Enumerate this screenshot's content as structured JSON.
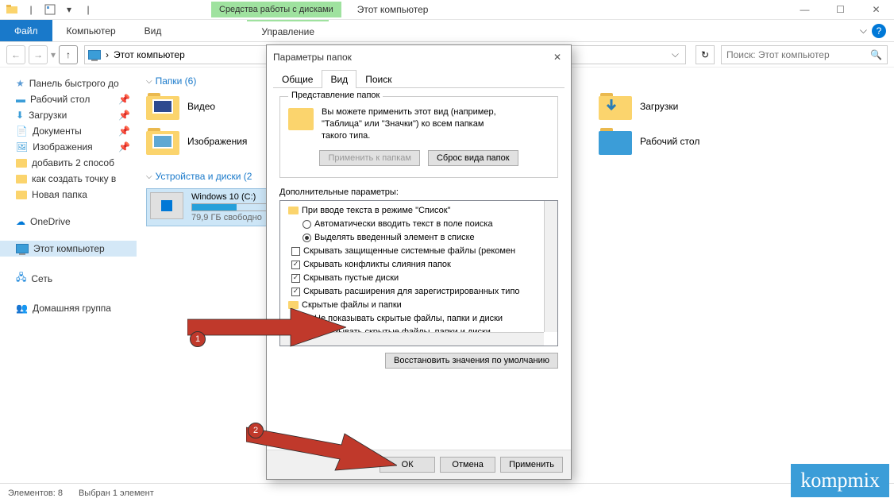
{
  "window": {
    "context_tab": "Средства работы с дисками",
    "app_title": "Этот компьютер"
  },
  "ribbon": {
    "file": "Файл",
    "computer": "Компьютер",
    "view": "Вид",
    "manage": "Управление"
  },
  "nav": {
    "location": "Этот компьютер",
    "search_placeholder": "Поиск: Этот компьютер"
  },
  "sidebar": {
    "quick": "Панель быстрого до",
    "desktop": "Рабочий стол",
    "downloads": "Загрузки",
    "documents": "Документы",
    "pictures": "Изображения",
    "add2": "добавить 2 способ",
    "howto": "как создать точку в",
    "newfolder": "Новая папка",
    "onedrive": "OneDrive",
    "thispc": "Этот компьютер",
    "network": "Сеть",
    "homegroup": "Домашняя группа"
  },
  "main": {
    "folders_header": "Папки (6)",
    "video": "Видео",
    "images": "Изображения",
    "downloads": "Загрузки",
    "desktop": "Рабочий стол",
    "drives_header": "Устройства и диски (2",
    "drive_name": "Windows 10 (C:)",
    "drive_free": "79,9 ГБ свободно"
  },
  "dialog": {
    "title": "Параметры папок",
    "tab_general": "Общие",
    "tab_view": "Вид",
    "tab_search": "Поиск",
    "fieldset_title": "Представление папок",
    "fieldset_text1": "Вы можете применить этот вид (например,",
    "fieldset_text2": "\"Таблица\" или \"Значки\") ко всем папкам",
    "fieldset_text3": "такого типа.",
    "apply_folders": "Применить к папкам",
    "reset_folders": "Сброс вида папок",
    "advanced_label": "Дополнительные параметры:",
    "tree": {
      "listmode": "При вводе текста в режиме \"Список\"",
      "auto": "Автоматически вводить текст в поле поиска",
      "highlight": "Выделять введенный элемент в списке",
      "hideprot": "Скрывать защищенные системные файлы (рекомен",
      "hidemerge": "Скрывать конфликты слияния папок",
      "hideempty": "Скрывать пустые диски",
      "hideext": "Скрывать расширения для зарегистрированных типо",
      "hidden": "Скрытые файлы и папки",
      "noshow": "Не показывать скрытые файлы, папки и диски",
      "show": "Показывать скрытые файлы, папки и диски"
    },
    "restore": "Восстановить значения по умолчанию",
    "ok": "ОК",
    "cancel": "Отмена",
    "apply": "Применить"
  },
  "status": {
    "elements": "Элементов: 8",
    "selected": "Выбран 1 элемент"
  },
  "markers": {
    "m1": "1",
    "m2": "2"
  },
  "watermark": "kompmix"
}
